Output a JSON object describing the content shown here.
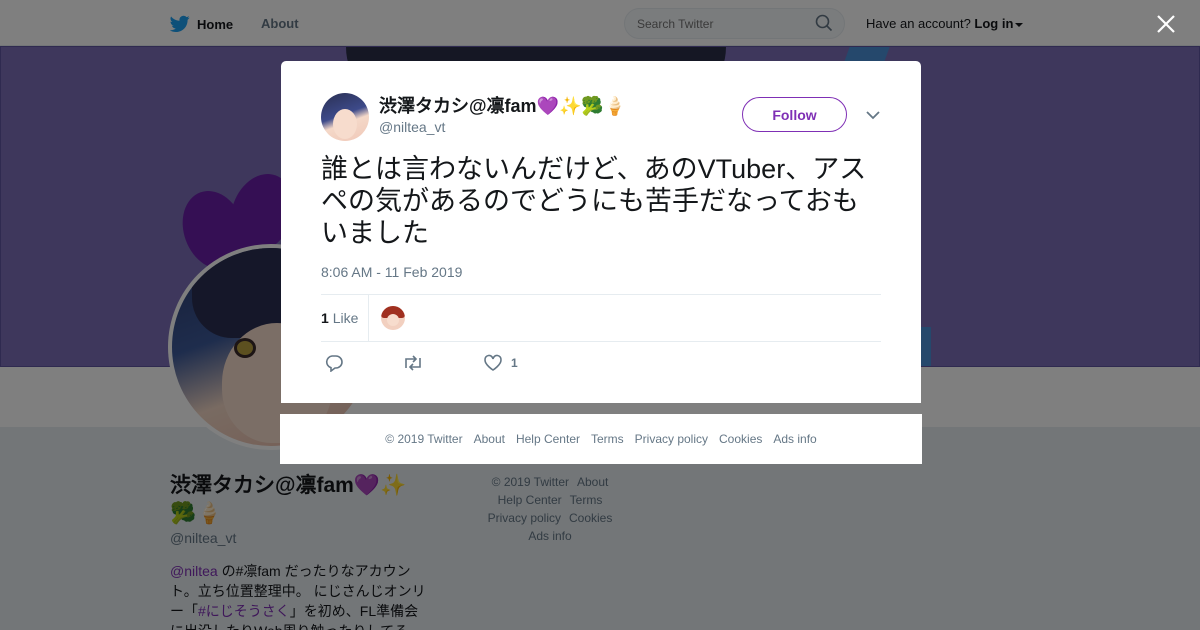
{
  "topbar": {
    "home_label": "Home",
    "about_label": "About",
    "search_placeholder": "Search Twitter",
    "have_account": "Have an account?",
    "login_label": "Log in"
  },
  "profile": {
    "name": "渋澤タカシ@凛fam💜✨🥦🍦",
    "handle": "@niltea_vt",
    "bio_link1": "@niltea",
    "bio_text1": " の#凛fam だったりなアカウント。立ち位置整理中。 にじさんじオンリー「",
    "bio_link2": "#にじそうさく",
    "bio_text2": "」を初め、FL準備会に出没したりWeb周り触ったりしてる"
  },
  "bg_footer": {
    "links": [
      "© 2019 Twitter",
      "About",
      "Help Center",
      "Terms",
      "Privacy policy",
      "Cookies",
      "Ads info"
    ]
  },
  "tweet": {
    "author_name": "渋澤タカシ@凛fam💜✨🥦🍦",
    "author_handle": "@niltea_vt",
    "follow_label": "Follow",
    "text": "誰とは言わないんだけど、あのVTuber、アスペの気があるのでどうにも苦手だなっておもいました",
    "timestamp": "8:06 AM - 11 Feb 2019",
    "likes_count": "1",
    "likes_label": "Like",
    "like_action_count": "1"
  },
  "modal_footer": {
    "links": [
      "© 2019 Twitter",
      "About",
      "Help Center",
      "Terms",
      "Privacy policy",
      "Cookies",
      "Ads info"
    ]
  },
  "colors": {
    "accent": "#7f2fb5",
    "twitter_blue": "#1da1f2",
    "muted": "#657786"
  },
  "icons": [
    "twitter-bird-icon",
    "search-icon",
    "close-icon",
    "chevron-down-icon",
    "reply-icon",
    "retweet-icon",
    "heart-icon"
  ]
}
